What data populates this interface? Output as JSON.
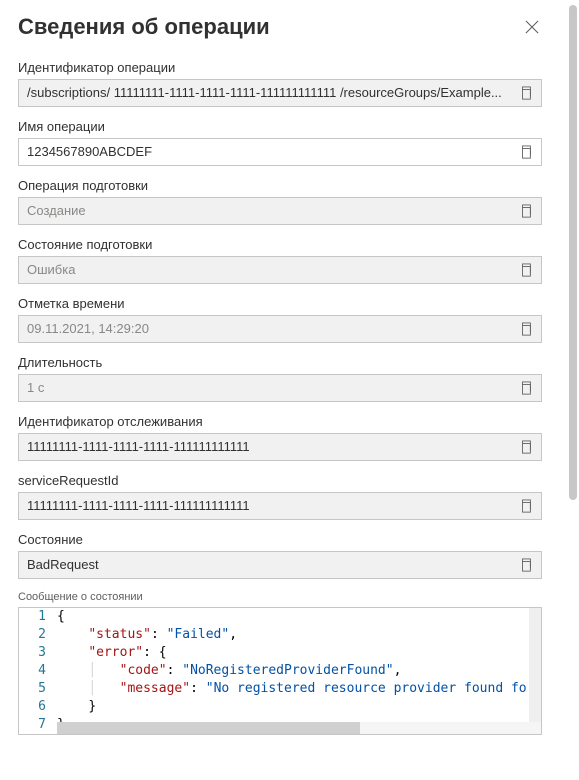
{
  "panel": {
    "title": "Сведения об операции"
  },
  "fields": {
    "operation_id": {
      "label": "Идентификатор операции",
      "value": "/subscriptions/ 11111111-1111-1111-1111-111111111111 /resourceGroups/Example..."
    },
    "operation_name": {
      "label": "Имя операции",
      "value": "1234567890ABCDEF"
    },
    "provisioning_op": {
      "label": "Операция подготовки",
      "value": "Создание"
    },
    "provisioning_state": {
      "label": "Состояние подготовки",
      "value": "Ошибка"
    },
    "timestamp": {
      "label": "Отметка времени",
      "value": "09.11.2021, 14:29:20"
    },
    "duration": {
      "label": "Длительность",
      "value": "1 с"
    },
    "tracking_id": {
      "label": "Идентификатор отслеживания",
      "value": "11111111-1111-1111-1111-111111111111"
    },
    "service_request_id": {
      "label": "serviceRequestId",
      "value": "11111111-1111-1111-1111-111111111111"
    },
    "status_code": {
      "label": "Состояние",
      "value": "BadRequest"
    },
    "status_message": {
      "label": "Сообщение о состоянии",
      "json": {
        "status": "Failed",
        "error": {
          "code": "NoRegisteredProviderFound",
          "message": "No registered resource provider found fo"
        }
      },
      "lines": [
        "1",
        "2",
        "3",
        "4",
        "5",
        "6",
        "7"
      ]
    }
  }
}
